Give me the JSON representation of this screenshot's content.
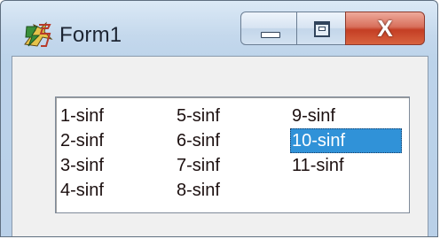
{
  "window": {
    "title": "Form1",
    "minimize_glyph": "minimize-icon",
    "maximize_glyph": "maximize-icon",
    "close_glyph": "X"
  },
  "listbox": {
    "columns": [
      [
        "1-sinf",
        "2-sinf",
        "3-sinf",
        "4-sinf"
      ],
      [
        "5-sinf",
        "6-sinf",
        "7-sinf",
        "8-sinf"
      ],
      [
        "9-sinf",
        "10-sinf",
        "11-sinf"
      ]
    ],
    "selected": "10-sinf"
  },
  "colors": {
    "selection": "#3092d8",
    "close_button": "#c43e24"
  }
}
